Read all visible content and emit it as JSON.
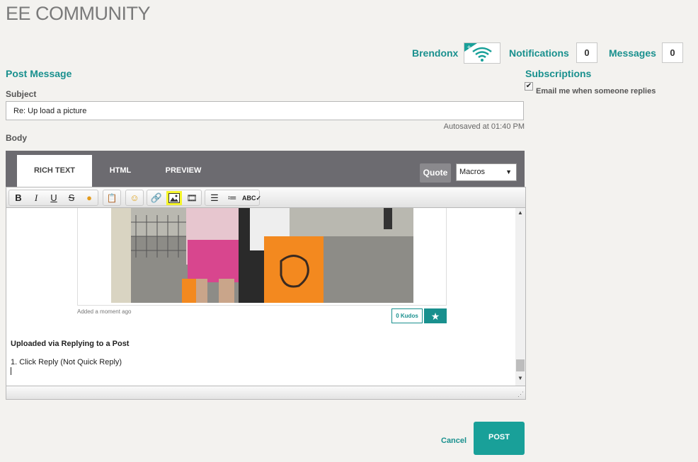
{
  "brand": "EE COMMUNITY",
  "header": {
    "username": "Brendonx",
    "notifications_label": "Notifications",
    "notifications_count": "0",
    "messages_label": "Messages",
    "messages_count": "0"
  },
  "form": {
    "title": "Post Message",
    "subject_label": "Subject",
    "subject_value": "Re: Up load a picture",
    "autosave": "Autosaved at 01:40 PM",
    "body_label": "Body"
  },
  "editor": {
    "tabs": [
      "RICH TEXT",
      "HTML",
      "PREVIEW"
    ],
    "active_tab": "RICH TEXT",
    "quote_label": "Quote",
    "macros_value": "Macros",
    "toolbar": [
      "bold-icon",
      "italic-icon",
      "underline-icon",
      "strikethrough-icon",
      "color-icon",
      "paste-icon",
      "emoji-icon",
      "link-icon",
      "image-icon",
      "video-icon",
      "numbered-list-icon",
      "bullet-list-icon",
      "spellcheck-icon"
    ],
    "image_caption": "Added a moment ago",
    "kudos_label": "0 Kudos",
    "content_bold": "Uploaded via Replying to a Post",
    "content_line": "1. Click Reply (Not Quick Reply)"
  },
  "actions": {
    "cancel_label": "Cancel",
    "post_label": "POST"
  },
  "subscriptions": {
    "title": "Subscriptions",
    "email_label": "Email me when someone replies",
    "email_checked": true
  },
  "colors": {
    "accent": "#19908e",
    "editor_header": "#6c6b70",
    "highlight": "#f5f52b"
  }
}
